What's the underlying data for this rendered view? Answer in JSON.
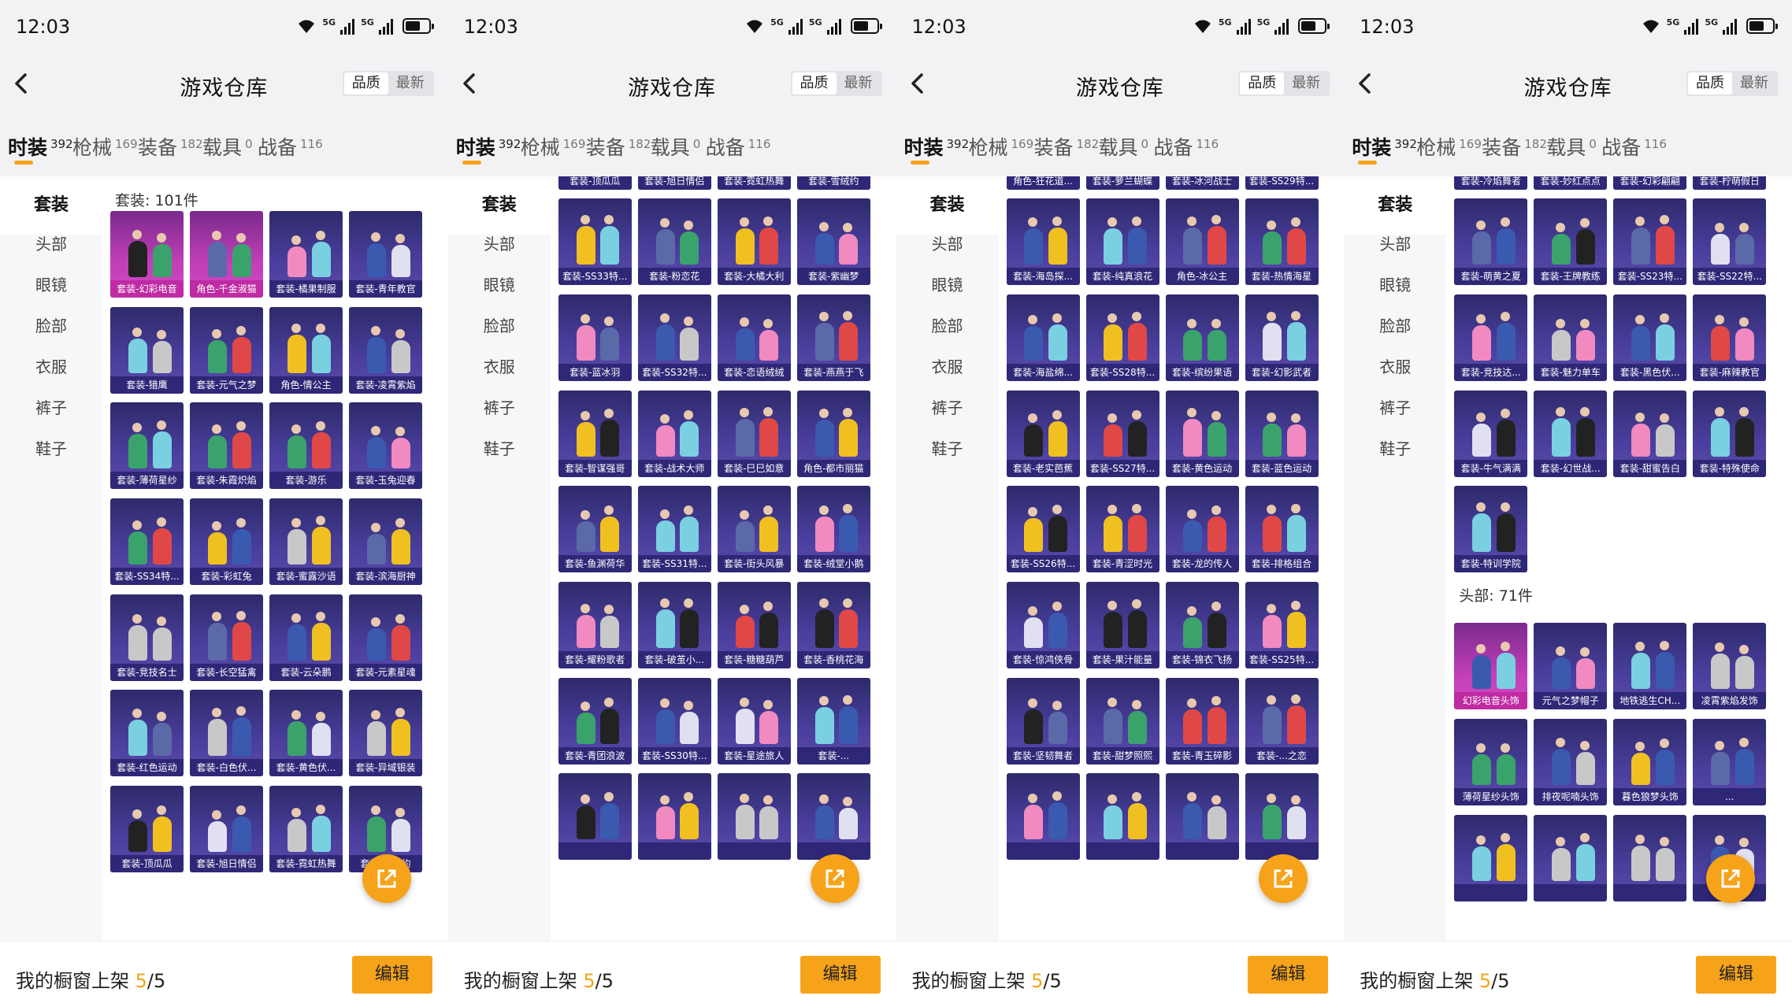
{
  "colors": {
    "accent": "#f6a31a",
    "card_bg": "#3f3590",
    "card_highlight": "#c23fb8"
  },
  "status": {
    "time": "12:03",
    "network": "5G"
  },
  "header": {
    "title": "游戏仓库",
    "sort_options": [
      "品质",
      "最新"
    ]
  },
  "tabs": [
    {
      "label": "时装",
      "count": "392"
    },
    {
      "label": "枪械",
      "count": "169"
    },
    {
      "label": "装备",
      "count": "182"
    },
    {
      "label": "载具",
      "count": "0"
    },
    {
      "label": "战备",
      "count": "116"
    }
  ],
  "sidebar": [
    "套装",
    "头部",
    "眼镜",
    "脸部",
    "衣服",
    "裤子",
    "鞋子"
  ],
  "bottom": {
    "shelf_label": "我的橱窗上架",
    "shelf_used": "5",
    "shelf_total": "/5",
    "edit_label": "编辑"
  },
  "panels": [
    {
      "sections": [
        {
          "title": "套装: 101件",
          "items": [
            {
              "label": "套装-幻彩电音",
              "highlight": true
            },
            {
              "label": "角色-千金淑猫",
              "highlight": true
            },
            {
              "label": "套装-橘果制服"
            },
            {
              "label": "套装-青年教官"
            },
            {
              "label": "套装-猎鹰"
            },
            {
              "label": "套装-元气之梦"
            },
            {
              "label": "角色-情公主"
            },
            {
              "label": "套装-凌霄紫焰"
            },
            {
              "label": "套装-薄荷星纱"
            },
            {
              "label": "套装-朱霞炽焰"
            },
            {
              "label": "套装-游乐"
            },
            {
              "label": "套装-玉兔迎春"
            },
            {
              "label": "套装-SS34特..."
            },
            {
              "label": "套装-彩虹兔"
            },
            {
              "label": "套装-蜜露沙语"
            },
            {
              "label": "套装-滨海厨神"
            },
            {
              "label": "套装-竞技名士"
            },
            {
              "label": "套装-长空猛禽"
            },
            {
              "label": "套装-云朵鹏"
            },
            {
              "label": "套装-元素星魂"
            },
            {
              "label": "套装-红色运动"
            },
            {
              "label": "套装-白色伏..."
            },
            {
              "label": "套装-黄色伏..."
            },
            {
              "label": "套装-异域银装"
            },
            {
              "label": "套装-顶瓜瓜"
            },
            {
              "label": "套装-旭日情侣"
            },
            {
              "label": "套装-霓虹热舞"
            },
            {
              "label": "套装-雪绒约"
            }
          ]
        }
      ]
    },
    {
      "sections": [
        {
          "title": "",
          "items": [
            {
              "label": "套装-顶瓜瓜"
            },
            {
              "label": "套装-旭日情侣"
            },
            {
              "label": "套装-霓虹热舞"
            },
            {
              "label": "套装-雪绒约"
            },
            {
              "label": "套装-SS33特..."
            },
            {
              "label": "套装-粉恋花"
            },
            {
              "label": "套装-大橘大利"
            },
            {
              "label": "套装-紫幽梦"
            },
            {
              "label": "套装-蓝冰羽"
            },
            {
              "label": "套装-SS32特..."
            },
            {
              "label": "套装-恋语绒绒"
            },
            {
              "label": "套装-燕燕于飞"
            },
            {
              "label": "套装-智谋强哥"
            },
            {
              "label": "套装-战术大师"
            },
            {
              "label": "套装-巳巳如意"
            },
            {
              "label": "角色-都市丽猫"
            },
            {
              "label": "套装-鱼渊荷华"
            },
            {
              "label": "套装-SS31特..."
            },
            {
              "label": "套装-街头风暴"
            },
            {
              "label": "套装-绒堂小鹅"
            },
            {
              "label": "套装-耀粉歌者"
            },
            {
              "label": "套装-破茧小..."
            },
            {
              "label": "套装-糖糖葫芦"
            },
            {
              "label": "套装-香桃花海"
            },
            {
              "label": "套装-青团浪波"
            },
            {
              "label": "套装-SS30特..."
            },
            {
              "label": "套装-星途旅人"
            },
            {
              "label": "套装-..."
            },
            {
              "label": ""
            },
            {
              "label": ""
            },
            {
              "label": ""
            },
            {
              "label": ""
            }
          ]
        }
      ]
    },
    {
      "sections": [
        {
          "title": "",
          "items": [
            {
              "label": "角色-狂花道..."
            },
            {
              "label": "套装-萝兰蝴蝶"
            },
            {
              "label": "套装-冰河战士"
            },
            {
              "label": "套装-SS29特..."
            },
            {
              "label": "套装-海岛探..."
            },
            {
              "label": "套装-纯真浪花"
            },
            {
              "label": "角色-冰公主"
            },
            {
              "label": "套装-热情海星"
            },
            {
              "label": "套装-海盐绵..."
            },
            {
              "label": "套装-SS28特..."
            },
            {
              "label": "套装-缤纷果语"
            },
            {
              "label": "套装-幻影武者"
            },
            {
              "label": "套装-老实芭蕉"
            },
            {
              "label": "套装-SS27特..."
            },
            {
              "label": "套装-黄色运动"
            },
            {
              "label": "套装-蓝色运动"
            },
            {
              "label": "套装-SS26特..."
            },
            {
              "label": "套装-青涩时光"
            },
            {
              "label": "套装-龙的传人"
            },
            {
              "label": "套装-排格组合"
            },
            {
              "label": "套装-惊鸿侠骨"
            },
            {
              "label": "套装-果汁能量"
            },
            {
              "label": "套装-锦衣飞扬"
            },
            {
              "label": "套装-SS25特..."
            },
            {
              "label": "套装-坚韧舞者"
            },
            {
              "label": "套装-甜梦照熙"
            },
            {
              "label": "套装-青玉碎影"
            },
            {
              "label": "套装-...之恋"
            },
            {
              "label": ""
            },
            {
              "label": ""
            },
            {
              "label": ""
            },
            {
              "label": ""
            }
          ]
        }
      ]
    },
    {
      "sections": [
        {
          "title": "",
          "items": [
            {
              "label": "套装-冷焰舞者"
            },
            {
              "label": "套装-妙红点点"
            },
            {
              "label": "套装-幻彩翩翩"
            },
            {
              "label": "套装-柠萌假日"
            },
            {
              "label": "套装-萌黄之夏"
            },
            {
              "label": "套装-王牌教练"
            },
            {
              "label": "套装-SS23特..."
            },
            {
              "label": "套装-SS22特..."
            },
            {
              "label": "套装-竞技达..."
            },
            {
              "label": "套装-魅力单车"
            },
            {
              "label": "套装-黑色伏..."
            },
            {
              "label": "套装-麻辣教官"
            },
            {
              "label": "套装-牛气满满"
            },
            {
              "label": "套装-幻世战..."
            },
            {
              "label": "套装-甜蜜告白"
            },
            {
              "label": "套装-特殊使命"
            },
            {
              "label": "套装-特训学院"
            }
          ]
        },
        {
          "title": "头部: 71件",
          "items": [
            {
              "label": "幻彩电音头饰",
              "highlight": true
            },
            {
              "label": "元气之梦帽子"
            },
            {
              "label": "地铁逃生CH..."
            },
            {
              "label": "凌霄紫焰发饰"
            },
            {
              "label": "薄荷星纱头饰"
            },
            {
              "label": "排夜呢喃头饰"
            },
            {
              "label": "暮色狼梦头饰"
            },
            {
              "label": "..."
            },
            {
              "label": ""
            },
            {
              "label": ""
            },
            {
              "label": ""
            },
            {
              "label": ""
            }
          ]
        }
      ]
    }
  ]
}
